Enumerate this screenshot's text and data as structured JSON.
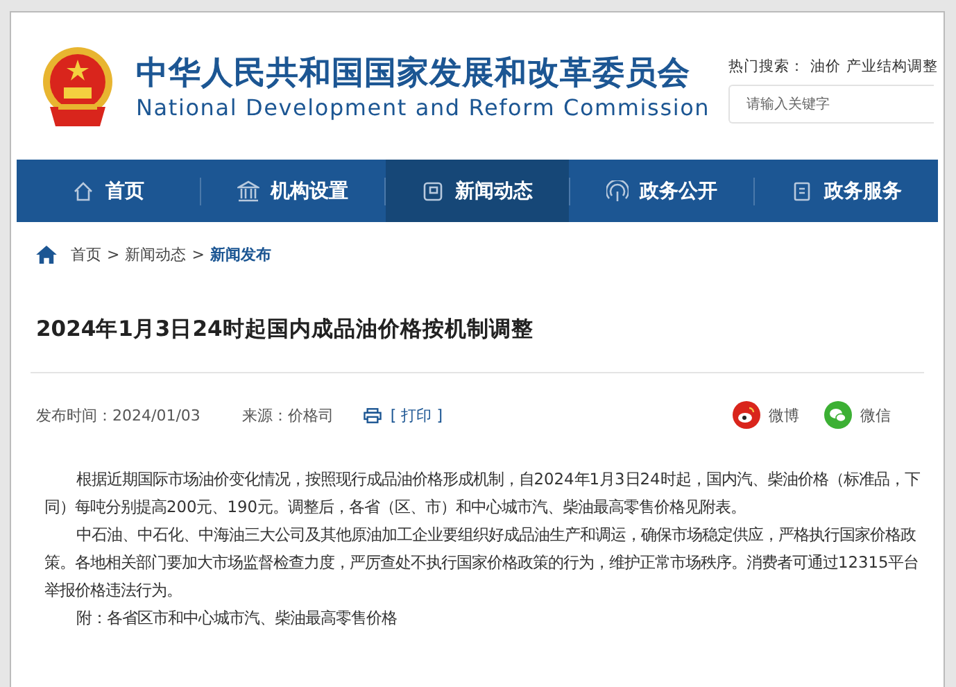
{
  "header": {
    "title_cn": "中华人民共和国国家发展和改革委员会",
    "title_en": "National Development and Reform Commission",
    "hot_search_label": "热门搜索：",
    "hot_search_terms": [
      "油价",
      "产业结构调整"
    ],
    "search": {
      "placeholder": "请输入关键字"
    }
  },
  "nav": [
    {
      "label": "首页",
      "kind": "home",
      "selected": false
    },
    {
      "label": "机构设置",
      "kind": "building",
      "selected": false
    },
    {
      "label": "新闻动态",
      "kind": "news",
      "selected": true
    },
    {
      "label": "政务公开",
      "kind": "signal",
      "selected": false
    },
    {
      "label": "政务服务",
      "kind": "doc",
      "selected": false
    }
  ],
  "breadcrumb_separator": ">",
  "breadcrumb": [
    {
      "label": "首页",
      "current": false
    },
    {
      "label": "新闻动态",
      "current": false
    },
    {
      "label": "新闻发布",
      "current": true
    }
  ],
  "article": {
    "title": "2024年1月3日24时起国内成品油价格按机制调整",
    "published": "发布时间：2024/01/03",
    "source": "来源：价格司",
    "print": "[ 打印 ]",
    "share": [
      {
        "kind": "weibo",
        "label": "微博"
      },
      {
        "kind": "wechat",
        "label": "微信"
      }
    ],
    "paragraphs": [
      "根据近期国际市场油价变化情况，按照现行成品油价格形成机制，自2024年1月3日24时起，国内汽、柴油价格（标准品，下同）每吨分别提高200元、190元。调整后，各省（区、市）和中心城市汽、柴油最高零售价格见附表。",
      "中石油、中石化、中海油三大公司及其他原油加工企业要组织好成品油生产和调运，确保市场稳定供应，严格执行国家价格政策。各地相关部门要加大市场监督检查力度，严厉查处不执行国家价格政策的行为，维护正常市场秩序。消费者可通过12315平台举报价格违法行为。",
      "附：各省区市和中心城市汽、柴油最高零售价格"
    ]
  }
}
